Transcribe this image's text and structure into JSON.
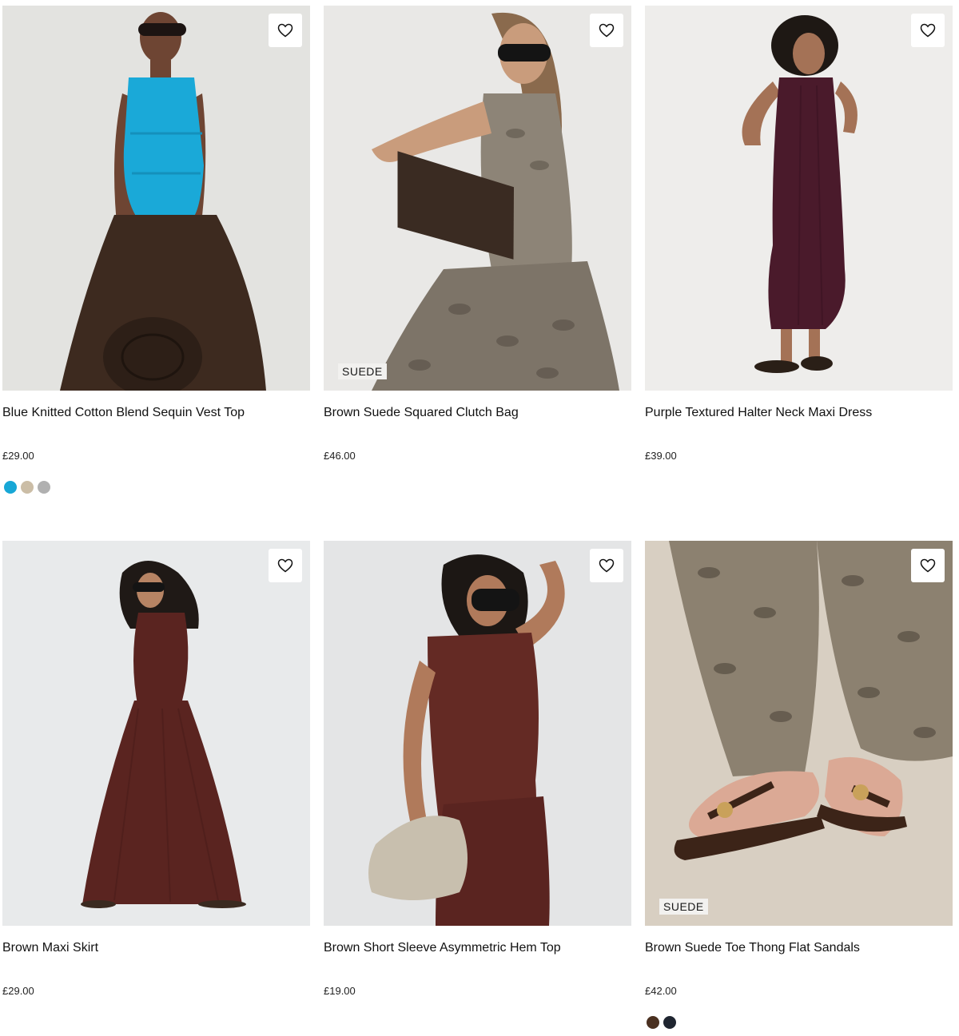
{
  "products": [
    {
      "name": "Blue Knitted Cotton Blend Sequin Vest Top",
      "price": "£29.00",
      "badge": "",
      "swatches": [
        "#17a7d6",
        "#cbbda6",
        "#b0b0b0"
      ],
      "image_colors": {
        "bg": "#e6e6e4",
        "top": "#1aa9d8",
        "bottom": "#3d2a1f",
        "skin": "#6e4533"
      }
    },
    {
      "name": "Brown Suede Squared Clutch Bag",
      "price": "£46.00",
      "badge": "SUEDE",
      "swatches": [],
      "image_colors": {
        "bg": "#e9e8e6",
        "top": "#8d8477",
        "bottom": "#7d7468",
        "skin": "#c99c7c"
      }
    },
    {
      "name": "Purple Textured Halter Neck Maxi Dress",
      "price": "£39.00",
      "badge": "",
      "swatches": [],
      "image_colors": {
        "bg": "#eeedeb",
        "top": "#4a1a2b",
        "bottom": "#4a1a2b",
        "skin": "#a47256"
      }
    },
    {
      "name": "Brown Maxi Skirt",
      "price": "£29.00",
      "badge": "",
      "swatches": [],
      "image_colors": {
        "bg": "#e8eaeb",
        "top": "#5a2420",
        "bottom": "#5a2420",
        "skin": "#b78464"
      }
    },
    {
      "name": "Brown Short Sleeve Asymmetric Hem Top",
      "price": "£19.00",
      "badge": "",
      "swatches": [],
      "image_colors": {
        "bg": "#e4e5e6",
        "top": "#642a24",
        "bottom": "#5a2420",
        "skin": "#b07a5b"
      }
    },
    {
      "name": "Brown Suede Toe Thong Flat Sandals",
      "price": "£42.00",
      "badge": "SUEDE",
      "swatches": [
        "#4a3020",
        "#1f2530"
      ],
      "image_colors": {
        "bg": "#d8cfc2",
        "top": "#8c8170",
        "bottom": "#8c8170",
        "skin": "#dba995"
      }
    }
  ],
  "icons": {
    "wishlist": "heart-outline-icon"
  }
}
